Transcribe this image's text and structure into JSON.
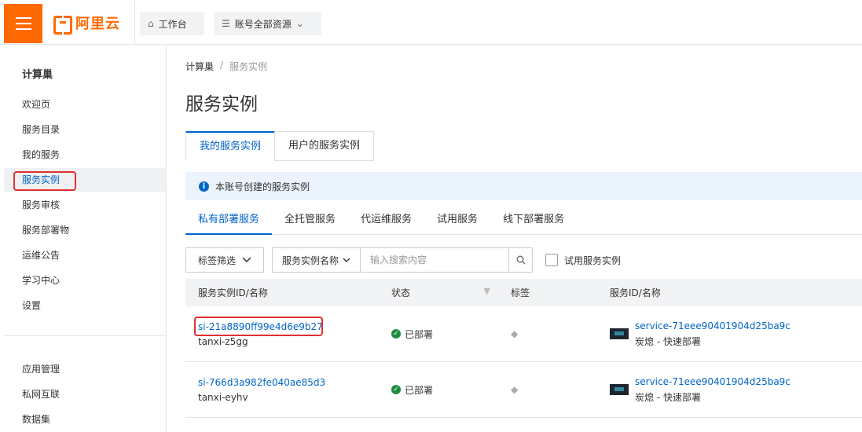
{
  "topbar": {
    "logo_text": "阿里云",
    "workbench_label": "工作台",
    "resources_label": "账号全部资源"
  },
  "sidebar": {
    "title": "计算巢",
    "items": [
      {
        "label": "欢迎页"
      },
      {
        "label": "服务目录"
      },
      {
        "label": "我的服务"
      },
      {
        "label": "服务实例",
        "active": true
      },
      {
        "label": "服务审核"
      },
      {
        "label": "服务部署物"
      },
      {
        "label": "运维公告"
      },
      {
        "label": "学习中心"
      },
      {
        "label": "设置"
      }
    ],
    "bottom_items": [
      {
        "label": "应用管理"
      },
      {
        "label": "私网互联"
      },
      {
        "label": "数据集"
      }
    ]
  },
  "breadcrumb": {
    "root": "计算巢",
    "sep": "/",
    "current": "服务实例"
  },
  "page_title": "服务实例",
  "tabs": [
    {
      "label": "我的服务实例",
      "active": true
    },
    {
      "label": "用户的服务实例"
    }
  ],
  "notice": {
    "text": "本账号创建的服务实例"
  },
  "subtabs": [
    {
      "label": "私有部署服务",
      "active": true
    },
    {
      "label": "全托管服务"
    },
    {
      "label": "代运维服务"
    },
    {
      "label": "试用服务"
    },
    {
      "label": "线下部署服务"
    }
  ],
  "filters": {
    "tag_filter_label": "标签筛选",
    "search_field_label": "服务实例名称",
    "search_placeholder": "输入搜索内容",
    "trial_checkbox_label": "试用服务实例"
  },
  "table": {
    "headers": [
      "服务实例ID/名称",
      "状态",
      "标签",
      "服务ID/名称"
    ],
    "rows": [
      {
        "id": "si-21a8890ff99e4d6e9b27",
        "name": "tanxi-z5gg",
        "status": "已部署",
        "service_id": "service-71eee90401904d25ba9c",
        "service_name": "炭熄 - 快速部署"
      },
      {
        "id": "si-766d3a982fe040ae85d3",
        "name": "tanxi-eyhv",
        "status": "已部署",
        "service_id": "service-71eee90401904d25ba9c",
        "service_name": "炭熄 - 快速部署"
      }
    ]
  },
  "colors": {
    "brand": "#ff6a00",
    "link": "#0064c8",
    "highlight": "#e03030",
    "success": "#1e8e3e"
  }
}
